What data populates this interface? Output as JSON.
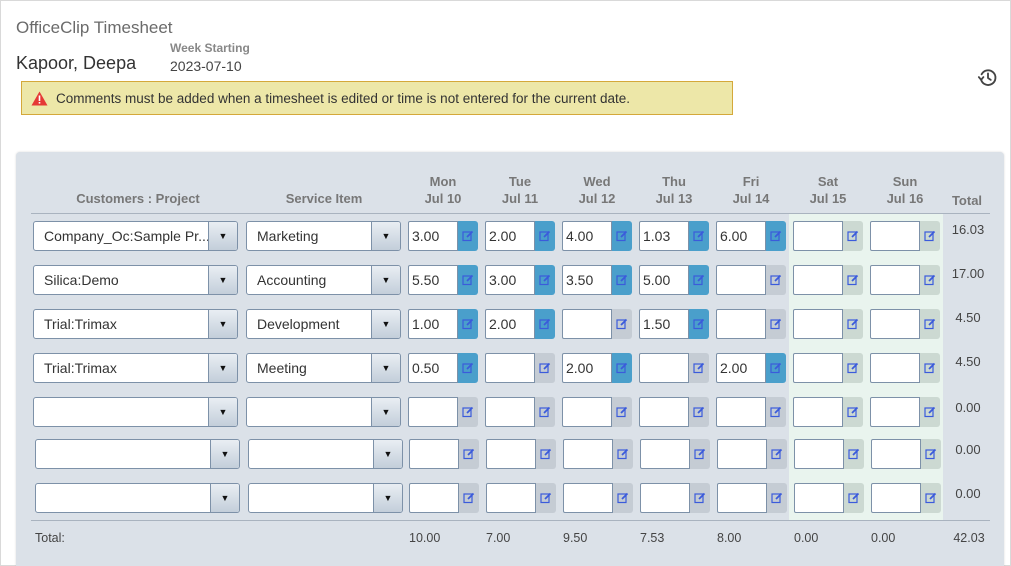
{
  "app": {
    "title": "OfficeClip Timesheet",
    "user_name": "Kapoor, Deepa",
    "week_label": "Week Starting",
    "week_value": "2023-07-10",
    "history_icon": "history-icon"
  },
  "alert": {
    "icon": "warning-triangle-icon",
    "message": "Comments must be added when a timesheet is edited or time is not entered for the current date."
  },
  "table": {
    "headers": {
      "project": "Customers : Project",
      "service": "Service Item",
      "total": "Total"
    },
    "days": [
      {
        "day": "Mon",
        "date": "Jul 10",
        "weekend": false
      },
      {
        "day": "Tue",
        "date": "Jul 11",
        "weekend": false
      },
      {
        "day": "Wed",
        "date": "Jul 12",
        "weekend": false
      },
      {
        "day": "Thu",
        "date": "Jul 13",
        "weekend": false
      },
      {
        "day": "Fri",
        "date": "Jul 14",
        "weekend": false
      },
      {
        "day": "Sat",
        "date": "Jul 15",
        "weekend": true
      },
      {
        "day": "Sun",
        "date": "Jul 16",
        "weekend": true
      }
    ],
    "rows": [
      {
        "project": "Company_Oc:Sample Pr...",
        "service": "Marketing",
        "hours": [
          "3.00",
          "2.00",
          "4.00",
          "1.03",
          "6.00",
          "",
          ""
        ],
        "total": "16.03"
      },
      {
        "project": "Silica:Demo",
        "service": "Accounting",
        "hours": [
          "5.50",
          "3.00",
          "3.50",
          "5.00",
          "",
          "",
          ""
        ],
        "total": "17.00"
      },
      {
        "project": "Trial:Trimax",
        "service": "Development",
        "hours": [
          "1.00",
          "2.00",
          "",
          "1.50",
          "",
          "",
          ""
        ],
        "total": "4.50"
      },
      {
        "project": "Trial:Trimax",
        "service": "Meeting",
        "hours": [
          "0.50",
          "",
          "2.00",
          "",
          "2.00",
          "",
          ""
        ],
        "total": "4.50"
      },
      {
        "project": "",
        "service": "",
        "hours": [
          "",
          "",
          "",
          "",
          "",
          "",
          ""
        ],
        "total": "0.00"
      },
      {
        "project": "",
        "service": "",
        "hours": [
          "",
          "",
          "",
          "",
          "",
          "",
          ""
        ],
        "total": "0.00"
      },
      {
        "project": "",
        "service": "",
        "hours": [
          "",
          "",
          "",
          "",
          "",
          "",
          ""
        ],
        "total": "0.00"
      }
    ],
    "footer": {
      "label": "Total:",
      "day_totals": [
        "10.00",
        "7.00",
        "9.50",
        "7.53",
        "8.00",
        "0.00",
        "0.00"
      ],
      "grand_total": "42.03"
    }
  },
  "colors": {
    "edit_active": "#4a9fcb",
    "edit_inactive": "#c5ccd4",
    "weekend_bg": "#e9f4ee",
    "alert_bg": "#ede7a8",
    "panel_bg": "#dbe1e8"
  }
}
